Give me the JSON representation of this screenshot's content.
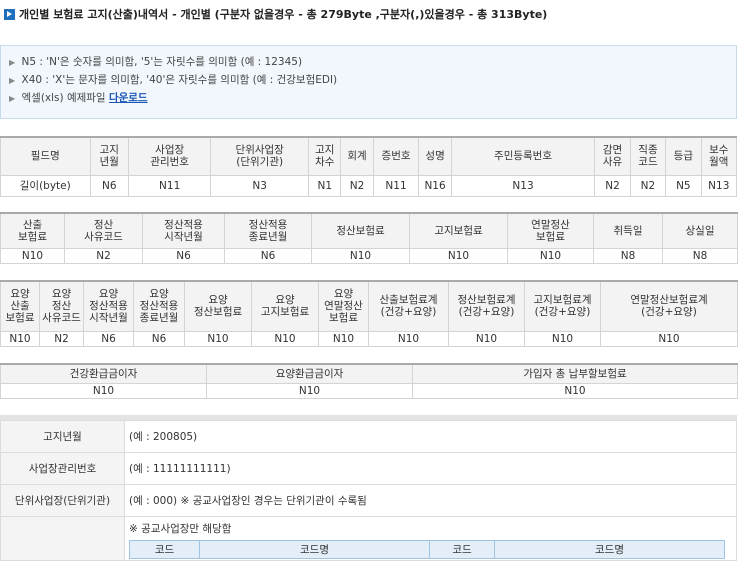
{
  "title": "개인별 보험료 고지(산출)내역서 - 개인별 (구분자 없을경우 - 총 279Byte ,구분자(,)있을경우 - 총 313Byte)",
  "notes": [
    "N5 : 'N'은 숫자를 의미함, '5'는 자릿수를 의미함 (예 : 12345)",
    "X40 : 'X'는 문자를 의미함, '40'은 자릿수를 의미함 (예 : 건강보험EDI)"
  ],
  "download": {
    "text": "엑셀(xls) 예제파일",
    "link": "다운로드"
  },
  "table1": {
    "headers": [
      "필드명",
      "고지\n년월",
      "사업장\n관리번호",
      "단위사업장\n(단위기관)",
      "고지\n차수",
      "회계",
      "증번호",
      "성명",
      "주민등록번호",
      "감면\n사유",
      "직종\n코드",
      "등급",
      "보수\n월액"
    ],
    "values": [
      "길이(byte)",
      "N6",
      "N11",
      "N3",
      "N1",
      "N2",
      "N11",
      "N16",
      "N13",
      "N2",
      "N2",
      "N5",
      "N13"
    ]
  },
  "table2": {
    "headers": [
      "산출\n보험료",
      "정산\n사유코드",
      "정산적용\n시작년월",
      "정산적용\n종료년월",
      "정산보험료",
      "고지보험료",
      "연말정산\n보험료",
      "취득일",
      "상실일"
    ],
    "values": [
      "N10",
      "N2",
      "N6",
      "N6",
      "N10",
      "N10",
      "N10",
      "N8",
      "N8"
    ]
  },
  "table3": {
    "headers": [
      "요양\n산출\n보험료",
      "요양\n정산\n사유코드",
      "요양\n정산적용\n시작년월",
      "요양\n정산적용\n종료년월",
      "요양\n정산보험료",
      "요양\n고지보험료",
      "요양\n연말정산\n보험료",
      "산출보험료계\n(건강+요양)",
      "정산보험료계\n(건강+요양)",
      "고지보험료계\n(건강+요양)",
      "연말정산보험료계\n(건강+요양)"
    ],
    "values": [
      "N10",
      "N2",
      "N6",
      "N6",
      "N10",
      "N10",
      "N10",
      "N10",
      "N10",
      "N10",
      "N10"
    ]
  },
  "table4": {
    "headers": [
      "건강환급금이자",
      "요양환급금이자",
      "가입자 총 납부할보험료"
    ],
    "values": [
      "N10",
      "N10",
      "N10"
    ]
  },
  "desc": [
    {
      "label": "고지년월",
      "value": "(예 : 200805)"
    },
    {
      "label": "사업장관리번호",
      "value": "(예 : 11111111111)"
    },
    {
      "label": "단위사업장(단위기관)",
      "value": "(예 : 000) ※ 공교사업장인 경우는 단위기관이 수록됨"
    }
  ],
  "desc_last": {
    "note": "※ 공교사업장만 해당함",
    "headers": [
      "코드",
      "코드명",
      "코드",
      "코드명"
    ]
  }
}
